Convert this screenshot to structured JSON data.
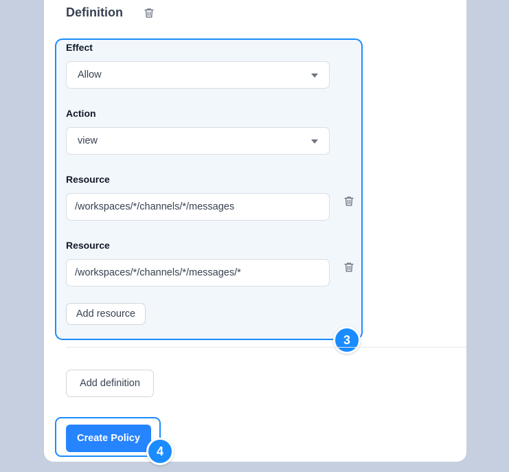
{
  "definition": {
    "title": "Definition",
    "effect": {
      "label": "Effect",
      "value": "Allow"
    },
    "action": {
      "label": "Action",
      "value": "view"
    },
    "resources": [
      {
        "label": "Resource",
        "value": "/workspaces/*/channels/*/messages"
      },
      {
        "label": "Resource",
        "value": "/workspaces/*/channels/*/messages/*"
      }
    ],
    "add_resource_label": "Add resource"
  },
  "add_definition_label": "Add definition",
  "create_policy_label": "Create Policy",
  "step_badges": {
    "definition_step": "3",
    "create_step": "4"
  },
  "colors": {
    "accent": "#1a8cff",
    "primary_button": "#2684ff",
    "background": "#c6cfdf"
  },
  "icons": {
    "delete": "trash-icon",
    "dropdown": "chevron-down-icon"
  }
}
